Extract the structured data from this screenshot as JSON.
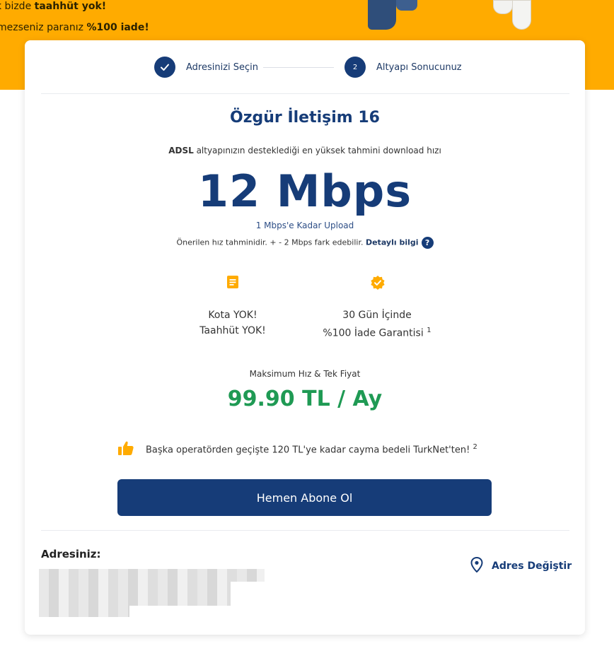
{
  "banner": {
    "line1_prefix": "k bizde ",
    "line1_bold": "taahhüt yok!",
    "line2_prefix": "mezseniz paranız ",
    "line2_bold": "%100 iade!"
  },
  "steps": [
    {
      "label": "Adresinizi Seçin",
      "state": "done",
      "icon": "check-icon"
    },
    {
      "label": "Altyapı Sonucunuz",
      "state": "current",
      "number": "2"
    }
  ],
  "plan": {
    "title": "Özgür İletişim 16",
    "infra_bold": "ADSL",
    "infra_text": " altyapınızın desteklediği en yüksek tahmini download hızı",
    "speed": "12 Mbps",
    "upload": "1 Mbps'e Kadar Upload",
    "note_text": "Önerilen hız tahminidir. + - 2 Mbps fark edebilir. ",
    "note_link": "Detaylı bilgi",
    "help_symbol": "?"
  },
  "features": [
    {
      "icon": "document-icon",
      "line1": "Kota YOK!",
      "line2": "Taahhüt YOK!",
      "sup": ""
    },
    {
      "icon": "badge-check-icon",
      "line1": "30 Gün İçinde",
      "line2": "%100 İade Garantisi",
      "sup": "1"
    }
  ],
  "pricing": {
    "label": "Maksimum Hız & Tek Fiyat",
    "price": "99.90 TL / Ay"
  },
  "promo": {
    "icon": "thumbs-up-icon",
    "text": "Başka operatörden geçişte 120 TL'ye kadar cayma bedeli TurkNet'ten!",
    "sup": "2"
  },
  "cta": {
    "label": "Hemen Abone Ol"
  },
  "address": {
    "title": "Adresiniz:",
    "change_label": "Adres Değiştir",
    "change_icon": "location-pin-icon"
  },
  "colors": {
    "brand": "#163c78",
    "banner": "#ffab00",
    "price": "#1f9a54",
    "accent_icon": "#ffab00"
  }
}
